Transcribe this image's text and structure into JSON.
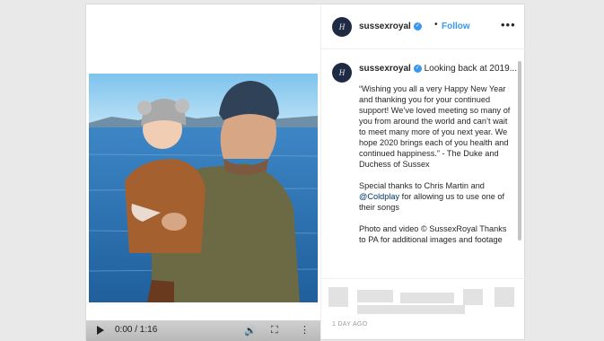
{
  "post": {
    "username": "sussexroyal",
    "avatar_monogram": "H",
    "follow_label": "Follow",
    "more_label": "•••",
    "caption_lead": "Looking back at 2019...",
    "caption_paragraphs": [
      "“Wishing you all a very Happy New Year and thanking you for your continued support! We’ve loved meeting so many of you from around the world and can’t wait to meet many more of you next year. We hope 2020 brings each of you health and continued happiness.” - The Duke and Duchess of Sussex",
      "Photo and video © SussexRoyal Thanks to PA for additional images and footage"
    ],
    "thanks_prefix": "Special thanks to Chris Martin and",
    "thanks_mention": "@Coldplay",
    "thanks_suffix": "for allowing us to use one of their songs",
    "timestamp": "1 DAY AGO"
  },
  "video": {
    "time": "0:00 / 1:16"
  },
  "colors": {
    "accent": "#3897f0",
    "mention": "#003569",
    "avatar_bg": "#1f2b44"
  }
}
